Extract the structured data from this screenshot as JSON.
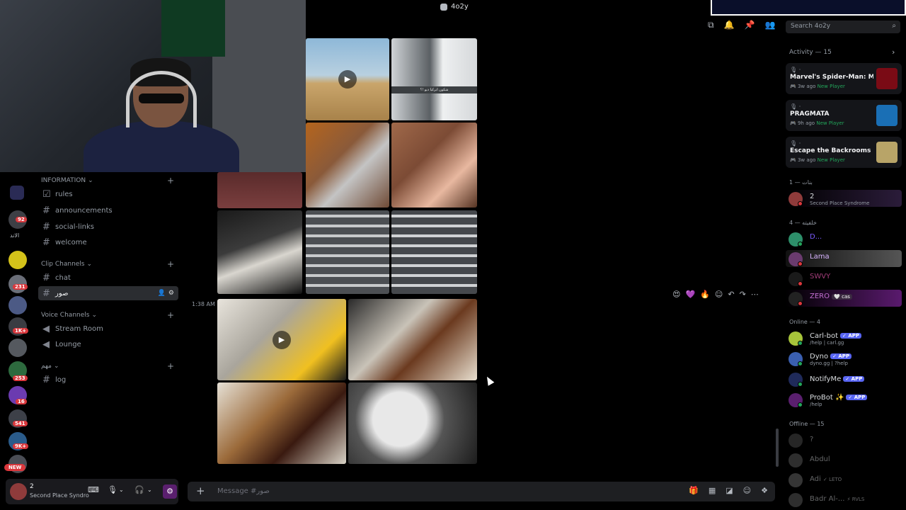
{
  "window": {
    "title": "4o2y"
  },
  "header": {
    "search_placeholder": "Search 4o2y"
  },
  "rail": {
    "badges": [
      "92",
      "231",
      "1K+",
      "253",
      "16",
      "541",
      "9K+"
    ],
    "text_label": "الاند",
    "new_label": "NEW"
  },
  "sidebar": {
    "categories": [
      {
        "label": "INFORMATION",
        "channels": [
          "rules",
          "announcements",
          "social-links",
          "welcome"
        ]
      },
      {
        "label": "Clip Channels",
        "channels": [
          "chat",
          "صور"
        ]
      },
      {
        "label": "Voice Channels",
        "channels": [
          "Stream Room",
          "Lounge"
        ]
      },
      {
        "label": "مهم",
        "channels": [
          "log"
        ]
      }
    ],
    "active_channel": "صور"
  },
  "user_panel": {
    "name": "2",
    "status": "Second Place Syndro"
  },
  "chat": {
    "timestamp": "1:38 AM",
    "image_caption": "شكون ابركيا ديو !؟",
    "composer_placeholder": "Message #صور"
  },
  "activity": {
    "header": "Activity — 15",
    "cards": [
      {
        "title": "Marvel's Spider-Man: Mile...",
        "time": "3w ago",
        "tag": "New Player",
        "art_color": "#7a0b15"
      },
      {
        "title": "PRAGMATA",
        "time": "9h ago",
        "tag": "New Player",
        "art_color": "#1a6fb5"
      },
      {
        "title": "Escape the Backrooms",
        "time": "3w ago",
        "tag": "New Player",
        "art_color": "#b8a468"
      }
    ]
  },
  "members": {
    "groups": [
      {
        "label": "بنات — 1",
        "members": [
          {
            "name": "2",
            "sub": "Second Place Syndrome",
            "color": "#dbdee1"
          }
        ]
      },
      {
        "label": "خلفيته — 4",
        "members": [
          {
            "name": "D...",
            "sub": "",
            "color": "#7a5cff"
          },
          {
            "name": "Lama",
            "sub": "",
            "color": "#d8b4ff"
          },
          {
            "name": "SWVY",
            "sub": "",
            "color": "#a33d7a"
          },
          {
            "name": "ZERO",
            "sub": "cas",
            "color": "#c26fd1"
          }
        ]
      },
      {
        "label": "Online — 4",
        "members": [
          {
            "name": "Carl-bot",
            "sub": "/help | carl.gg",
            "app": "APP"
          },
          {
            "name": "Dyno",
            "sub": "dyno.gg | ?help",
            "app": "APP"
          },
          {
            "name": "NotifyMe",
            "sub": "",
            "app": "APP"
          },
          {
            "name": "ProBot ✨",
            "sub": "/help",
            "app": "APP"
          }
        ]
      },
      {
        "label": "Offline — 15",
        "members": [
          {
            "name": "?",
            "sub": ""
          },
          {
            "name": "Abdul",
            "sub": ""
          },
          {
            "name": "Adi",
            "sub": "LETO"
          },
          {
            "name": "Badr Al-...",
            "sub": "RVLS"
          }
        ]
      }
    ]
  },
  "colors": {
    "accent": "#5865f2",
    "online": "#23a55a",
    "dnd": "#da373c",
    "idle": "#f0b232"
  }
}
